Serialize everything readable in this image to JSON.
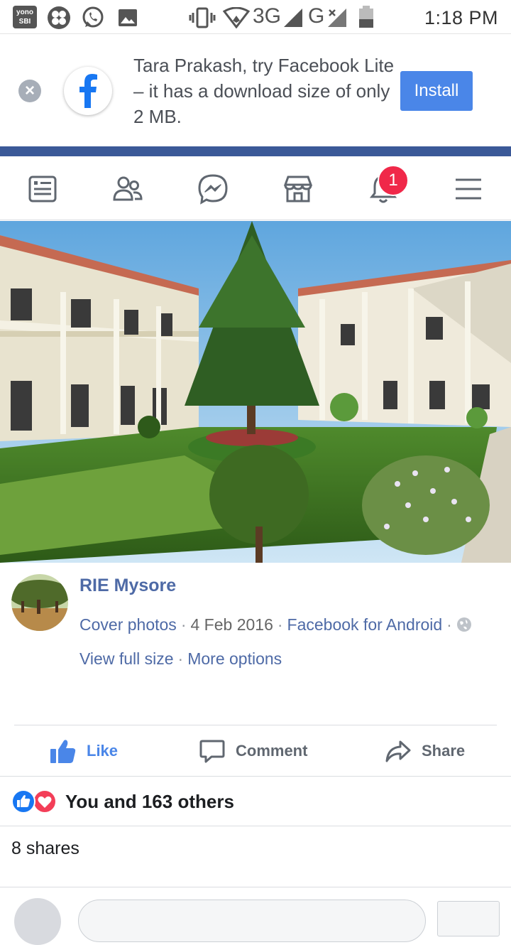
{
  "status_bar": {
    "time": "1:18 PM",
    "app_badge": "yono SBI",
    "network_1": "3G",
    "network_2": "G"
  },
  "banner": {
    "message": "Tara Prakash, try Facebook Lite – it has a download size of only 2 MB.",
    "install_label": "Install",
    "logo_letter": "f"
  },
  "nav": {
    "notification_count": "1",
    "items": [
      "news-feed",
      "friends",
      "messenger",
      "marketplace",
      "notifications",
      "menu"
    ]
  },
  "post": {
    "page_name": "RIE Mysore",
    "album": "Cover photos",
    "date": "4 Feb 2016",
    "source": "Facebook for Android",
    "view_full_size": "View full size",
    "more_options": "More options"
  },
  "actions": {
    "like": "Like",
    "comment": "Comment",
    "share": "Share"
  },
  "reactions": {
    "summary": "You and 163 others"
  },
  "shares": {
    "count_text": "8 shares"
  },
  "colors": {
    "facebook_blue": "#3b5998",
    "link_blue": "#4e6aa6",
    "like_blue": "#4a86e8",
    "badge_red": "#f02849"
  }
}
